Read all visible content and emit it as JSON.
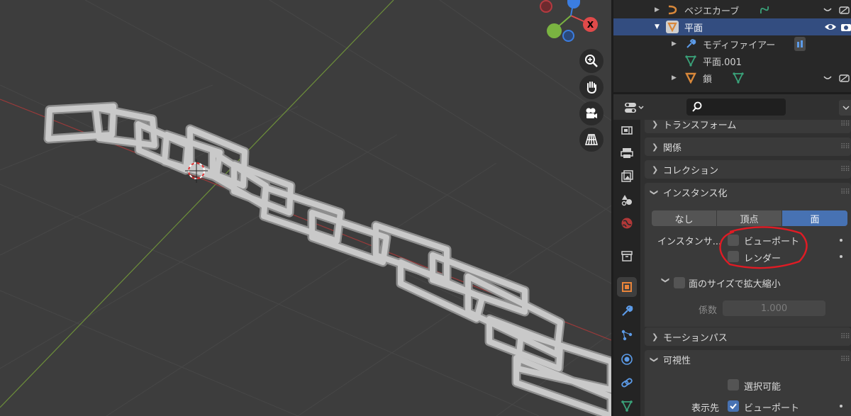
{
  "outliner": {
    "items": [
      {
        "label": "ベジエカーブ",
        "icon": "bezier-curve-icon",
        "selected": false,
        "expanded": false
      },
      {
        "label": "平面",
        "icon": "mesh-object-icon",
        "selected": true,
        "expanded": true
      },
      {
        "label": "モディファイアー",
        "icon": "wrench-icon",
        "selected": false,
        "expanded": false
      },
      {
        "label": "平面.001",
        "icon": "mesh-data-icon",
        "selected": false,
        "expanded": false
      },
      {
        "label": "鎖",
        "icon": "mesh-object-icon",
        "selected": false,
        "expanded": false
      }
    ]
  },
  "properties": {
    "search": {
      "placeholder": ""
    },
    "panels": {
      "transform": "トランスフォーム",
      "relations": "関係",
      "collections": "コレクション",
      "instancing": "インスタンス化",
      "motion_paths": "モーションパス",
      "visibility": "可視性"
    },
    "instancing": {
      "options": [
        "なし",
        "頂点",
        "面"
      ],
      "selected": "面",
      "instancer_label": "インスタンサ...",
      "viewport_label": "ビューポート",
      "render_label": "レンダー",
      "scale_by_face": "面のサイズで拡大縮小",
      "factor_label": "係数",
      "factor_value": "1.000"
    },
    "visibility": {
      "selectable": "選択可能",
      "show_in_label": "表示先",
      "viewport_label": "ビューポート"
    }
  },
  "viewport": {
    "gizmo": {
      "x_axis_label": "X"
    }
  },
  "colors": {
    "accent": "#4772b3",
    "selection": "#334d80",
    "x_axis": "#e04a4a",
    "y_axis": "#7ab341",
    "z_axis": "#3b7de0",
    "annotation_circle": "#e01b24"
  }
}
